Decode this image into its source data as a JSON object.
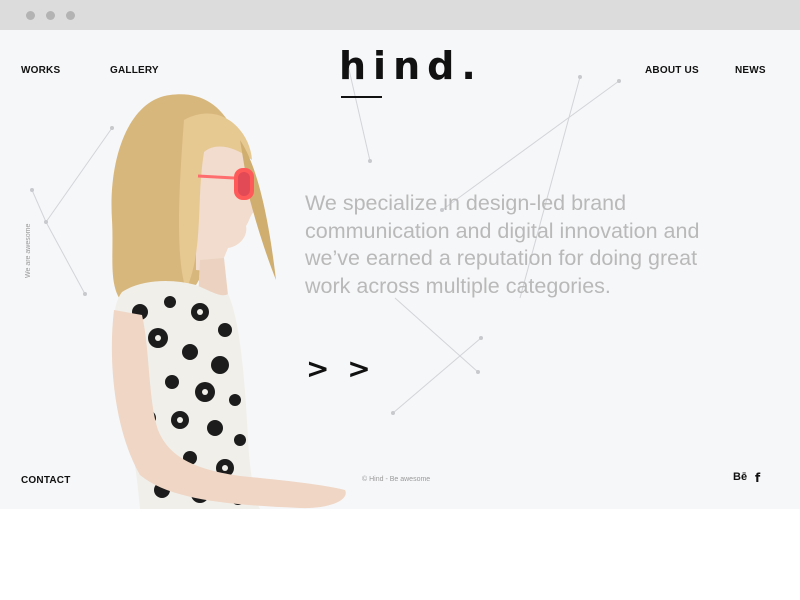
{
  "browser": {
    "dots": [
      "close",
      "minimize",
      "maximize"
    ]
  },
  "header": {
    "logo": "hind.",
    "nav_left": [
      "WORKS",
      "GALLERY"
    ],
    "nav_right": [
      "ABOUT US",
      "NEWS"
    ]
  },
  "sidebar": {
    "vertical_text": "We are awesome"
  },
  "hero": {
    "tagline": "We specialize in design-led brand communication and digital innovation and we’ve earned a reputation for doing great work across multiple categories.",
    "next_arrows": "> >"
  },
  "footer": {
    "contact": "CONTACT",
    "copyright": "© Hind - Be awesome",
    "social": {
      "behance": "Bē",
      "facebook": "f"
    }
  },
  "colors": {
    "background": "#f6f7f9",
    "text_dark": "#111111",
    "tagline_grey": "#b9b9b9",
    "sunglasses": "#ff5a5a"
  }
}
